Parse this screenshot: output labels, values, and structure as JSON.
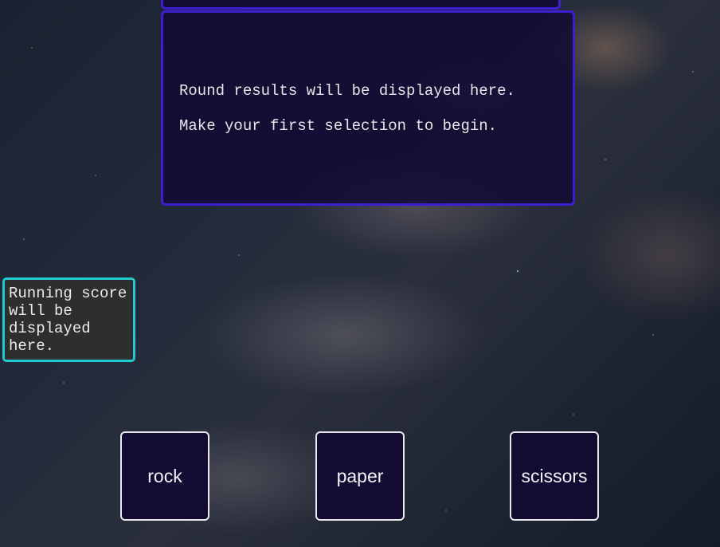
{
  "results": {
    "message_line1": "Round results will be displayed here.",
    "message_line2": "Make your first selection to begin."
  },
  "score": {
    "message": "Running score will be displayed here."
  },
  "choices": {
    "rock": "rock",
    "paper": "paper",
    "scissors": "scissors"
  },
  "colors": {
    "panel_border": "#3b1fd1",
    "score_border": "#1ecbd0",
    "button_bg": "#130b32",
    "button_border": "#e8e8ee"
  }
}
